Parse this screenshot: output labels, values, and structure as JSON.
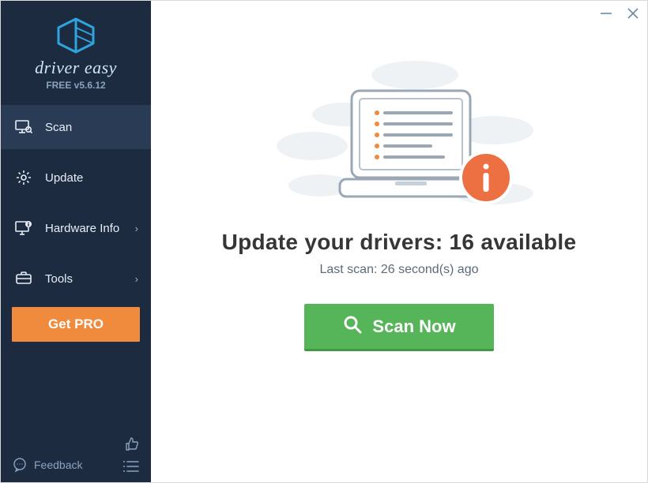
{
  "brand": {
    "name": "driver easy",
    "version": "FREE v5.6.12"
  },
  "sidebar": {
    "items": [
      {
        "label": "Scan",
        "icon": "scan-monitor-icon",
        "active": true
      },
      {
        "label": "Update",
        "icon": "gear-icon"
      },
      {
        "label": "Hardware Info",
        "icon": "hardware-info-icon",
        "chevron": true
      },
      {
        "label": "Tools",
        "icon": "tools-icon",
        "chevron": true
      }
    ],
    "get_pro_label": "Get PRO",
    "feedback_label": "Feedback"
  },
  "main": {
    "headline": "Update your drivers: 16 available",
    "subline": "Last scan: 26 second(s) ago",
    "scan_button_label": "Scan Now"
  },
  "colors": {
    "sidebar_bg": "#1d2b40",
    "accent_orange": "#f08a3c",
    "scan_green": "#57b559",
    "info_orange": "#ed7043"
  }
}
